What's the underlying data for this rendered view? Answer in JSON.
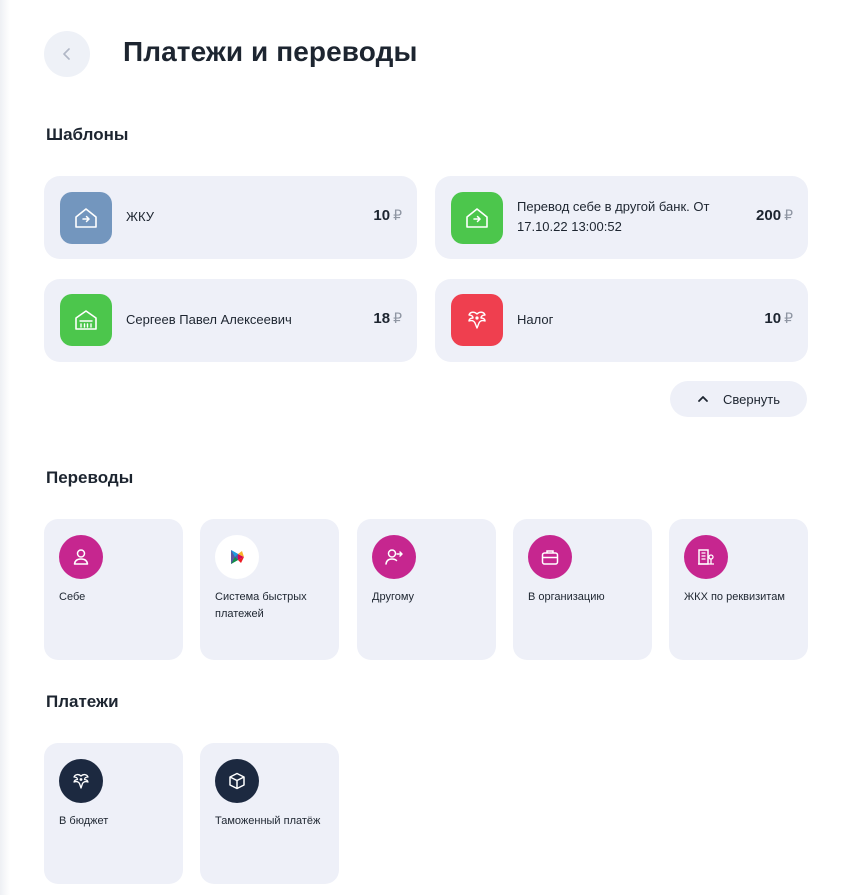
{
  "header": {
    "title": "Платежи и переводы",
    "back_icon": "chevron-left-icon"
  },
  "templates": {
    "title": "Шаблоны",
    "items": [
      {
        "name": "ЖКУ",
        "amount": "10",
        "currency": "₽",
        "icon": "house-arrow-icon",
        "icon_color": "#7396be"
      },
      {
        "name": "Перевод себе в другой банк. От 17.10.22 13:00:52",
        "amount": "200",
        "currency": "₽",
        "icon": "house-arrow-icon",
        "icon_color": "#4cc64c"
      },
      {
        "name": "Сергеев Павел Алексеевич",
        "amount": "18",
        "currency": "₽",
        "icon": "bank-icon",
        "icon_color": "#4cc64c"
      },
      {
        "name": "Налог",
        "amount": "10",
        "currency": "₽",
        "icon": "emblem-icon",
        "icon_color": "#ef3f4f"
      }
    ],
    "collapse_label": "Свернуть"
  },
  "transfers": {
    "title": "Переводы",
    "items": [
      {
        "label": "Себе",
        "icon": "person-icon"
      },
      {
        "label": "Система быстрых платежей",
        "icon": "sbp-logo-icon"
      },
      {
        "label": "Другому",
        "icon": "person-arrow-icon"
      },
      {
        "label": "В организацию",
        "icon": "briefcase-icon"
      },
      {
        "label": "ЖКХ по реквизитам",
        "icon": "building-icon"
      }
    ]
  },
  "payments": {
    "title": "Платежи",
    "items": [
      {
        "label": "В бюджет",
        "icon": "emblem-icon"
      },
      {
        "label": "Таможенный платёж",
        "icon": "box-icon"
      }
    ]
  },
  "colors": {
    "accent_magenta": "#c6268f",
    "navy": "#1c2940",
    "card_bg": "#eef0f8"
  }
}
